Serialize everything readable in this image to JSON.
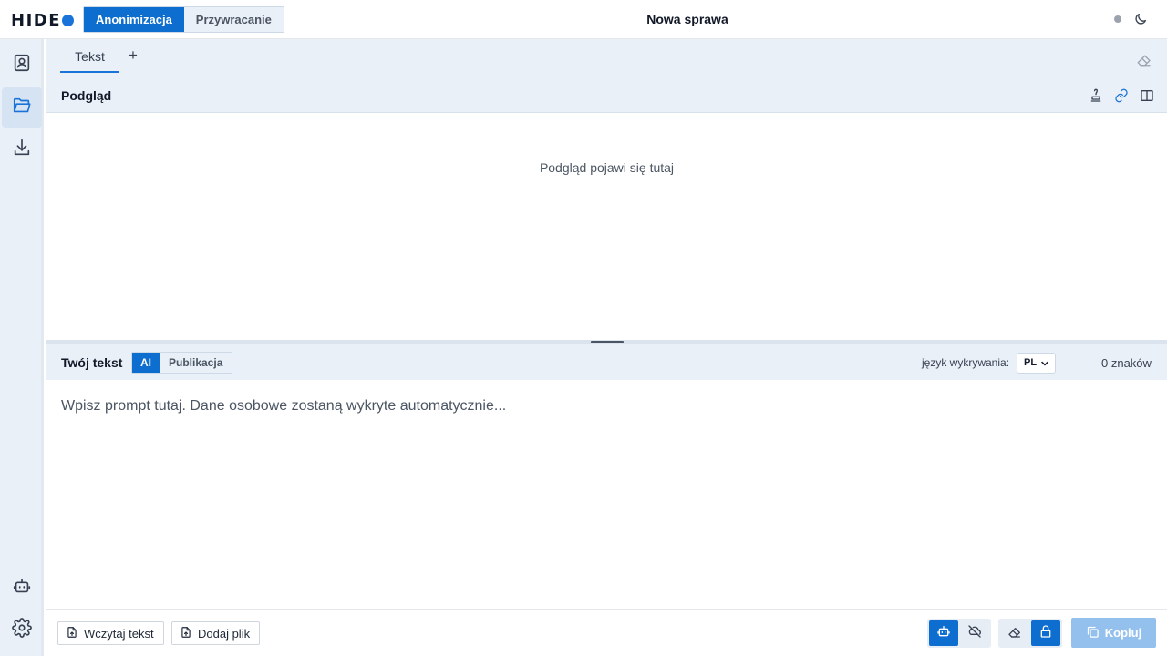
{
  "app": {
    "logo": "HIDE",
    "title": "Nowa sprawa"
  },
  "mode": {
    "anon_label": "Anonimizacja",
    "restore_label": "Przywracanie"
  },
  "tabs": [
    {
      "label": "Tekst"
    }
  ],
  "tab_add": "+",
  "preview": {
    "title": "Podgląd",
    "placeholder": "Podgląd pojawi się tutaj"
  },
  "input": {
    "title": "Twój tekst",
    "ai_label": "AI",
    "publication_label": "Publikacja",
    "lang_label": "język wykrywania:",
    "lang_value": "PL",
    "char_count": "0 znaków",
    "placeholder": "Wpisz prompt tutaj. Dane osobowe zostaną wykryte automatycznie..."
  },
  "footer": {
    "load_text": "Wczytaj tekst",
    "add_file": "Dodaj plik",
    "copy": "Kopiuj"
  },
  "colors": {
    "accent": "#0d6ecf",
    "panel": "#e9f0f8",
    "copy_disabled": "#93c0ec"
  }
}
